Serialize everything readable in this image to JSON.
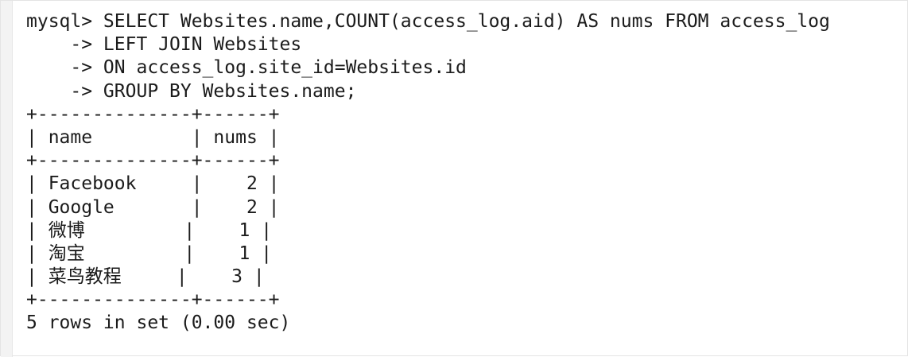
{
  "terminal": {
    "lines": [
      "mysql> SELECT Websites.name,COUNT(access_log.aid) AS nums FROM access_log",
      "    -> LEFT JOIN Websites",
      "    -> ON access_log.site_id=Websites.id",
      "    -> GROUP BY Websites.name;",
      "+--------------+------+",
      "| name         | nums |",
      "+--------------+------+",
      "| Facebook     |    2 |",
      "| Google       |    2 |",
      "| 微博         |    1 |",
      "| 淘宝         |    1 |",
      "| 菜鸟教程     |    3 |",
      "+--------------+------+",
      "5 rows in set (0.00 sec)"
    ]
  }
}
